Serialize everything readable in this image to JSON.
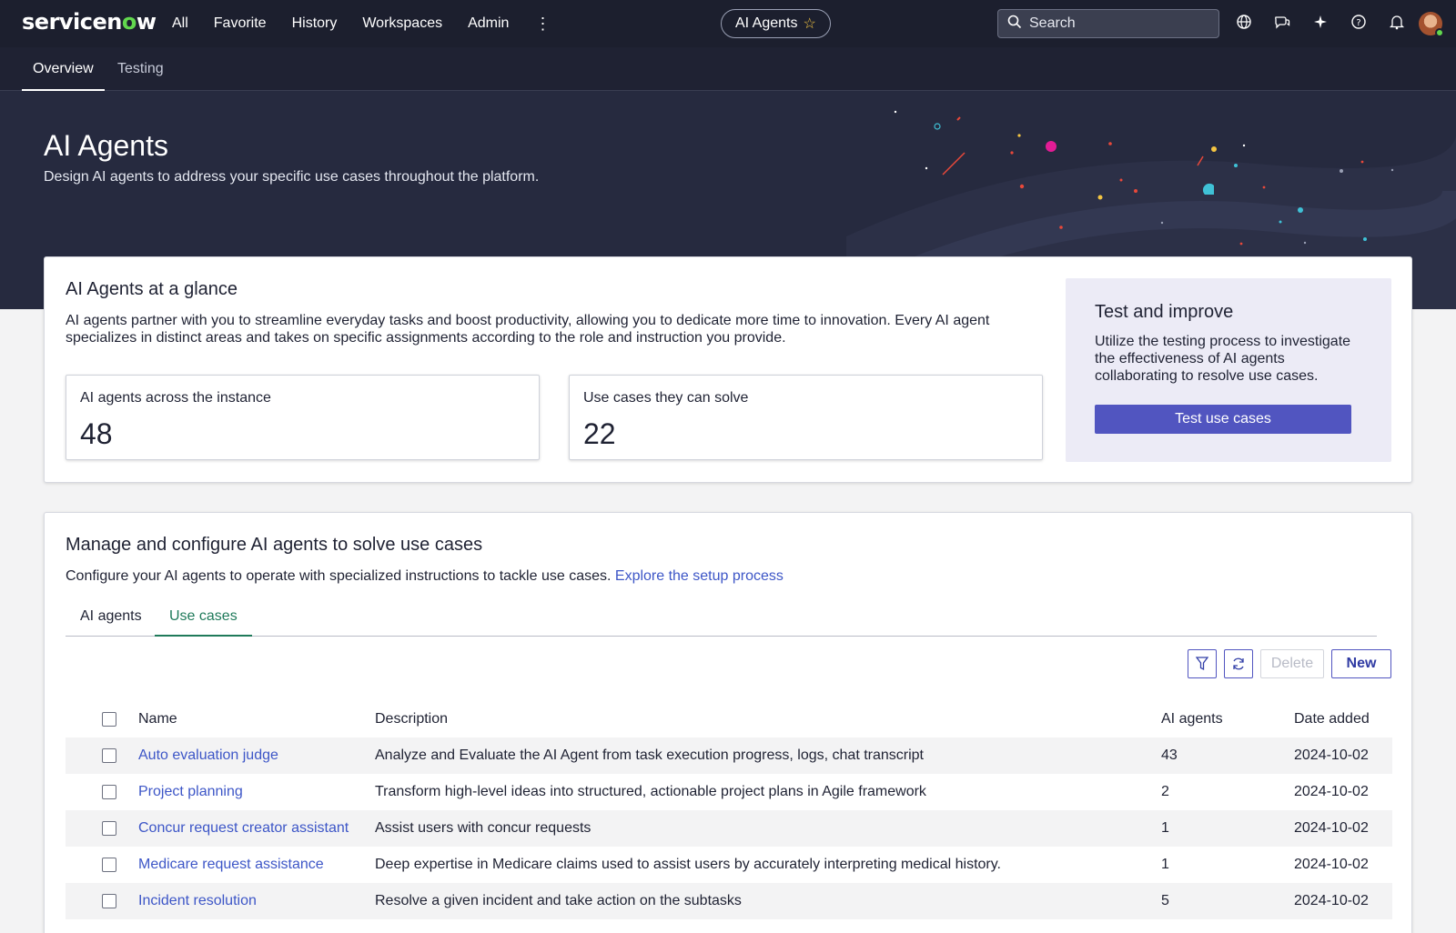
{
  "topnav": {
    "logo_prefix": "servicen",
    "logo_o": "o",
    "logo_suffix": "w",
    "items": [
      "All",
      "Favorite",
      "History",
      "Workspaces",
      "Admin"
    ],
    "context_pill": "AI Agents",
    "search_placeholder": "Search",
    "icons": [
      "globe-icon",
      "chat-icon",
      "sparkle-icon",
      "help-icon",
      "bell-icon"
    ]
  },
  "subnav": {
    "tabs": [
      "Overview",
      "Testing"
    ],
    "active": "Overview"
  },
  "hero": {
    "title": "AI Agents",
    "subtitle": "Design AI agents to address your specific use cases throughout the platform."
  },
  "glance": {
    "title": "AI Agents at a glance",
    "description": "AI agents partner with you to streamline everyday tasks and boost productivity, allowing you to dedicate more time to innovation. Every AI agent specializes in distinct areas and takes on specific assignments according to the role and instruction you provide.",
    "stats": [
      {
        "label": "AI agents across the instance",
        "value": "48"
      },
      {
        "label": "Use cases they can solve",
        "value": "22"
      }
    ],
    "improve": {
      "title": "Test and improve",
      "text": "Utilize the testing process to investigate the effectiveness of AI agents collaborating to resolve use cases.",
      "button": "Test use cases"
    }
  },
  "manage": {
    "title": "Manage and configure AI agents to solve use cases",
    "description": "Configure your AI agents to operate with specialized instructions to tackle use cases. ",
    "link": "Explore the setup process",
    "tabs": [
      "AI agents",
      "Use cases"
    ],
    "active_tab": "Use cases",
    "toolbar": {
      "delete": "Delete",
      "new": "New"
    },
    "columns": [
      "Name",
      "Description",
      "AI agents",
      "Date added"
    ],
    "rows": [
      {
        "name": "Auto evaluation judge",
        "description": "Analyze and Evaluate the AI Agent from task execution progress, logs, chat transcript",
        "agents": "43",
        "date": "2024-10-02"
      },
      {
        "name": "Project planning",
        "description": "Transform high-level ideas into structured, actionable project plans in Agile framework",
        "agents": "2",
        "date": "2024-10-02"
      },
      {
        "name": "Concur request creator assistant",
        "description": "Assist users with concur requests",
        "agents": "1",
        "date": "2024-10-02"
      },
      {
        "name": "Medicare request assistance",
        "description": "Deep expertise in Medicare claims used to assist users by accurately interpreting medical history.",
        "agents": "1",
        "date": "2024-10-02"
      },
      {
        "name": "Incident resolution",
        "description": "Resolve a given incident and take action on the subtasks",
        "agents": "5",
        "date": "2024-10-02"
      }
    ]
  },
  "colors": {
    "topbar": "#1c1f2e",
    "hero": "#262a3f",
    "primary_button": "#5155c0",
    "link": "#3d56c7",
    "active_tab": "#1f7a5a"
  }
}
